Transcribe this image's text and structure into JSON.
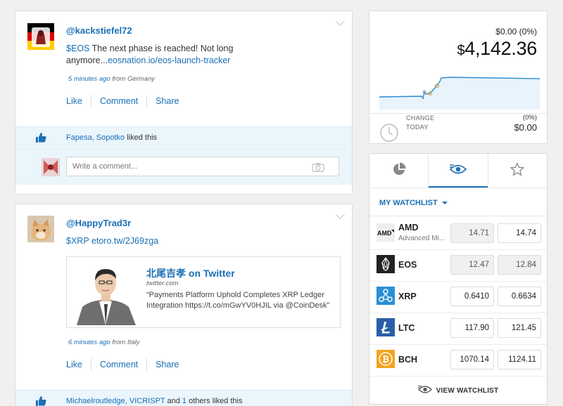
{
  "posts": [
    {
      "username": "@kackstiefel72",
      "text_prefix": "$EOS",
      "text_body": " The next phase is reached! Not long anymore...",
      "text_link": "eosnation.io/eos-launch-tracker",
      "time": "5 minutes ago",
      "origin": " from Germany",
      "actions": [
        "Like",
        "Comment",
        "Share"
      ],
      "liked_by": "Fapesa, Sopotko",
      "liked_suffix": " liked this",
      "comment_placeholder": "Write a comment..."
    },
    {
      "username": "@HappyTrad3r",
      "text_prefix": "$XRP",
      "text_link": " etoro.tw/2J69zga",
      "embed": {
        "title": "北尾吉孝 on Twitter",
        "domain": "twitter.com",
        "quote": "“Payments Platform Uphold Completes XRP Ledger Integration https://t.co/mGwYV0HJIL via @CoinDesk”"
      },
      "time": "6 minutes ago",
      "origin": " from Italy",
      "actions": [
        "Like",
        "Comment",
        "Share"
      ],
      "liked_by": "Michaelroutledge, VICRISPT",
      "liked_mid": " and ",
      "liked_count": "1",
      "liked_suffix": " others liked this"
    }
  ],
  "price": {
    "change_top": "$0.00 (0%)",
    "currency": "$",
    "amount": "4,142.36",
    "change_label_1": "CHANGE",
    "change_label_2": "TODAY",
    "change_pct": "(0%)",
    "change_val": "$0.00"
  },
  "watchlist": {
    "title": "MY WATCHLIST",
    "view_label": "VIEW WATCHLIST",
    "tab_icons": [
      "pie-chart-icon",
      "eye-icon",
      "star-icon"
    ],
    "items": [
      {
        "symbol": "AMD",
        "name": "Advanced Mi...",
        "bid": "14.71",
        "ask": "14.74",
        "icon": "amd-logo-icon"
      },
      {
        "symbol": "EOS",
        "name": "",
        "bid": "12.47",
        "ask": "12.84",
        "icon": "eos-logo-icon"
      },
      {
        "symbol": "XRP",
        "name": "",
        "bid": "0.6410",
        "ask": "0.6634",
        "icon": "xrp-logo-icon"
      },
      {
        "symbol": "LTC",
        "name": "",
        "bid": "117.90",
        "ask": "121.45",
        "icon": "ltc-logo-icon"
      },
      {
        "symbol": "BCH",
        "name": "",
        "bid": "1070.14",
        "ask": "1124.11",
        "icon": "bch-logo-icon"
      }
    ]
  },
  "colors": {
    "accent": "#1a6fb5",
    "like_bar": "#eaf5fc",
    "xrp": "#2a8fd6",
    "ltc": "#2a5ea8",
    "bch": "#f4a321",
    "eos": "#222222"
  }
}
